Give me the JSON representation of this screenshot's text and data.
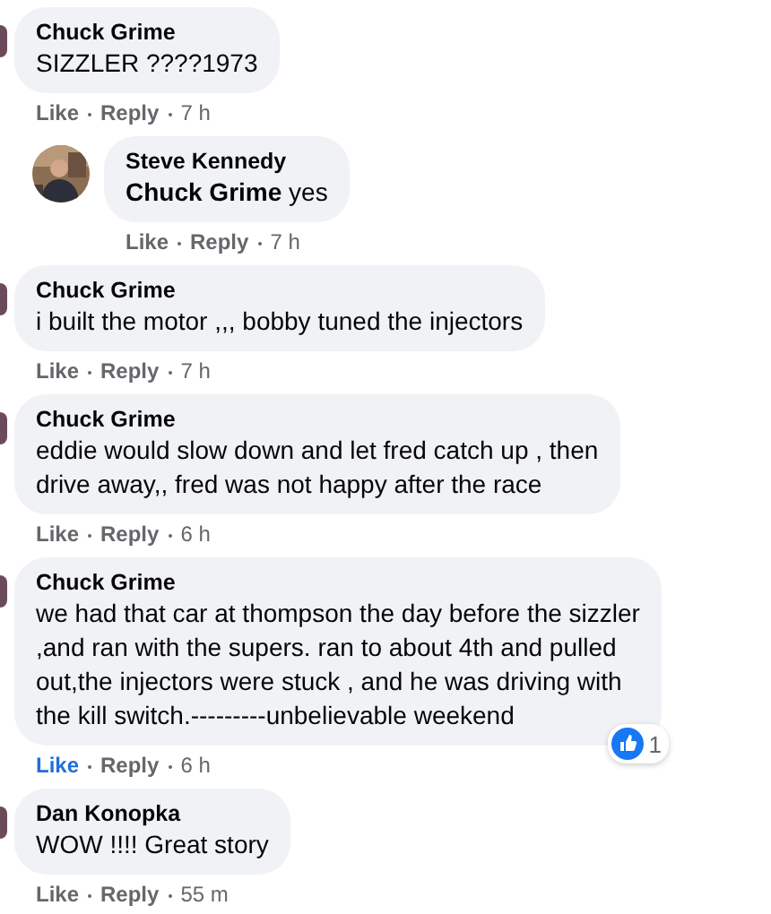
{
  "comments": [
    {
      "author": "Chuck Grime",
      "text": "SIZZLER ????1973",
      "like": "Like",
      "reply": "Reply",
      "time": "7 h",
      "liked": false,
      "replies": [
        {
          "author": "Steve Kennedy",
          "text": "**Chuck Grime** yes",
          "like": "Like",
          "reply": "Reply",
          "time": "7 h",
          "liked": false
        }
      ]
    },
    {
      "author": "Chuck Grime",
      "text": "i built the motor ,,, bobby tuned the injectors",
      "like": "Like",
      "reply": "Reply",
      "time": "7 h",
      "liked": false
    },
    {
      "author": "Chuck Grime",
      "text": "eddie would slow down and let fred catch up , then\ndrive away,, fred was not happy after the race",
      "like": "Like",
      "reply": "Reply",
      "time": "6 h",
      "liked": false
    },
    {
      "author": "Chuck Grime",
      "text": "we had that car at thompson the day before the sizzler\n,and ran with the supers. ran to about 4th and pulled\nout,the injectors were stuck , and he was driving with\nthe kill switch.---------unbelievable weekend",
      "like": "Like",
      "reply": "Reply",
      "time": "6 h",
      "liked": true,
      "reactions": "1"
    },
    {
      "author": "Dan Konopka",
      "text": "WOW !!!! Great story",
      "like": "Like",
      "reply": "Reply",
      "time": "55 m",
      "liked": false
    }
  ]
}
